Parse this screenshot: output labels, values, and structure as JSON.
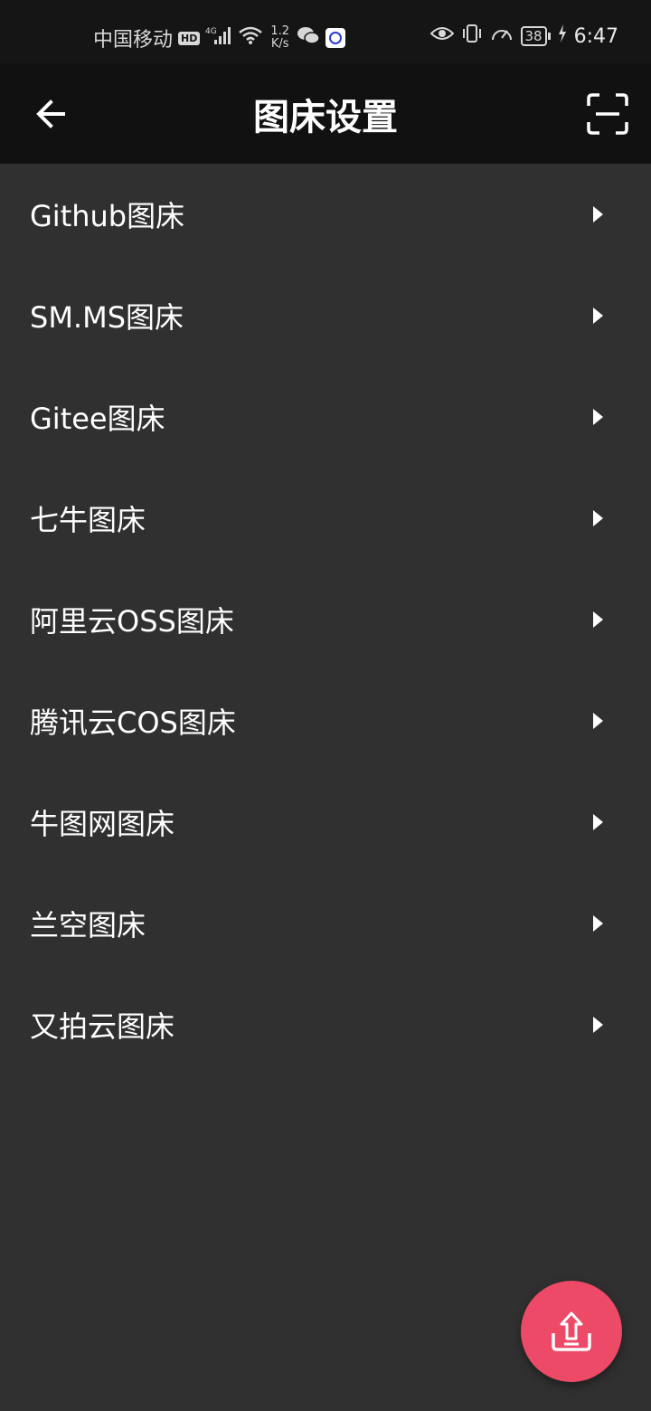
{
  "status_bar": {
    "carrier": "中国移动",
    "hd": "HD",
    "network": "4G",
    "speed_value": "1.2",
    "speed_unit": "K/s",
    "battery": "38",
    "time": "6:47"
  },
  "app_bar": {
    "title": "图床设置",
    "back_icon": "arrow-left-icon",
    "scan_icon": "scan-icon"
  },
  "menu": {
    "items": [
      {
        "label": "Github图床"
      },
      {
        "label": "SM.MS图床"
      },
      {
        "label": "Gitee图床"
      },
      {
        "label": "七牛图床"
      },
      {
        "label": "阿里云OSS图床"
      },
      {
        "label": "腾讯云COS图床"
      },
      {
        "label": "牛图网图床"
      },
      {
        "label": "兰空图床"
      },
      {
        "label": "又拍云图床"
      }
    ]
  },
  "fab": {
    "icon": "upload-icon",
    "color": "#ec4a66"
  },
  "colors": {
    "background": "#303030",
    "app_bar": "#111111",
    "status_bar": "#151515"
  }
}
